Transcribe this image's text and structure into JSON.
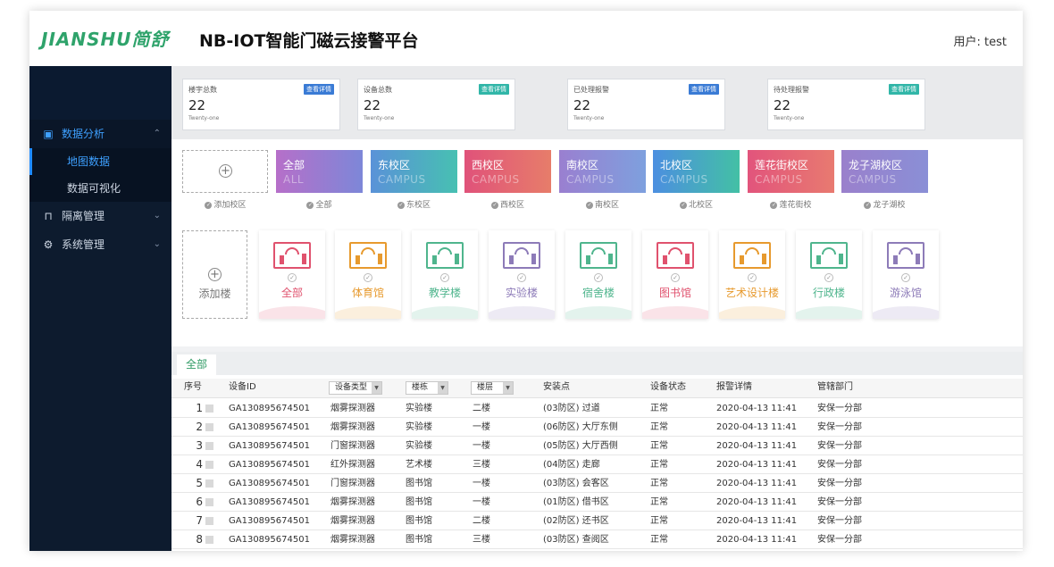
{
  "header": {
    "logo_text": "JIANSHU简舒",
    "title": "NB-IOT智能门磁云接警平台",
    "user_label": "用户: test"
  },
  "sidebar": {
    "groups": [
      {
        "label": "数据分析",
        "icon": "monitor-icon",
        "expanded": true,
        "items": [
          {
            "label": "地图数据",
            "active": true
          },
          {
            "label": "数据可视化",
            "active": false
          }
        ]
      },
      {
        "label": "隔离管理",
        "icon": "door-icon",
        "expanded": false
      },
      {
        "label": "系统管理",
        "icon": "gear-icon",
        "expanded": false
      }
    ]
  },
  "stats": [
    {
      "label": "楼宇总数",
      "badge": "查看详情",
      "value": "22",
      "sub": "Twenty-one",
      "badge_color": "#3a7bd5"
    },
    {
      "label": "设备总数",
      "badge": "查看详情",
      "value": "22",
      "sub": "Twenty-one",
      "badge_color": "#31b6a8"
    },
    {
      "label": "已处理报警",
      "badge": "查看详情",
      "value": "22",
      "sub": "Twenty-one",
      "badge_color": "#3a7bd5"
    },
    {
      "label": "待处理报警",
      "badge": "查看详情",
      "value": "22",
      "sub": "Twenty-one",
      "badge_color": "#31b6a8"
    }
  ],
  "campus": {
    "add_label": "添加校区",
    "items": [
      {
        "name": "全部",
        "sub": "ALL",
        "caption": "全部",
        "color_from": "#b66fc9",
        "color_to": "#7d87d8"
      },
      {
        "name": "东校区",
        "sub": "CAMPUS",
        "caption": "东校区",
        "color_from": "#5a92d8",
        "color_to": "#47c0b2"
      },
      {
        "name": "西校区",
        "sub": "CAMPUS",
        "caption": "西校区",
        "color_from": "#e0527a",
        "color_to": "#e77d6a"
      },
      {
        "name": "南校区",
        "sub": "CAMPUS",
        "caption": "南校区",
        "color_from": "#9a7fd0",
        "color_to": "#7ea0de"
      },
      {
        "name": "北校区",
        "sub": "CAMPUS",
        "caption": "北校区",
        "color_from": "#4c8fe0",
        "color_to": "#43c0a5"
      },
      {
        "name": "莲花街校区",
        "sub": "CAMPUS",
        "caption": "莲花街校",
        "color_from": "#e2547c",
        "color_to": "#e87a70"
      },
      {
        "name": "龙子湖校区",
        "sub": "CAMPUS",
        "caption": "龙子湖校",
        "color_from": "#9a80cc",
        "color_to": "#8a8fd6"
      }
    ]
  },
  "buildings": {
    "add_label": "添加楼",
    "items": [
      {
        "name": "全部",
        "color": "#e0526e"
      },
      {
        "name": "体育馆",
        "color": "#e79a2e"
      },
      {
        "name": "教学楼",
        "color": "#4fb58d"
      },
      {
        "name": "实验楼",
        "color": "#8d7bb8"
      },
      {
        "name": "宿舍楼",
        "color": "#4fb58d"
      },
      {
        "name": "图书馆",
        "color": "#e0526e"
      },
      {
        "name": "艺术设计楼",
        "color": "#e79a2e"
      },
      {
        "name": "行政楼",
        "color": "#4fb58d"
      },
      {
        "name": "游泳馆",
        "color": "#8d7bb8"
      }
    ]
  },
  "table": {
    "tab": "全部",
    "headers": [
      "序号",
      "设备ID",
      "设备类型",
      "楼栋",
      "楼层",
      "安装点",
      "设备状态",
      "报警详情",
      "管辖部门"
    ],
    "rows": [
      [
        "1",
        "GA130895674501",
        "烟雾探测器",
        "实验楼",
        "二楼",
        "(03防区) 过道",
        "正常",
        "2020-04-13 11:41",
        "安保一分部"
      ],
      [
        "2",
        "GA130895674501",
        "烟雾探测器",
        "实验楼",
        "一楼",
        "(06防区) 大厅东侧",
        "正常",
        "2020-04-13 11:41",
        "安保一分部"
      ],
      [
        "3",
        "GA130895674501",
        "门窗探测器",
        "实验楼",
        "一楼",
        "(05防区) 大厅西侧",
        "正常",
        "2020-04-13 11:41",
        "安保一分部"
      ],
      [
        "4",
        "GA130895674501",
        "红外探测器",
        "艺术楼",
        "三楼",
        "(04防区) 走廊",
        "正常",
        "2020-04-13 11:41",
        "安保一分部"
      ],
      [
        "5",
        "GA130895674501",
        "门窗探测器",
        "图书馆",
        "一楼",
        "(03防区) 会客区",
        "正常",
        "2020-04-13 11:41",
        "安保一分部"
      ],
      [
        "6",
        "GA130895674501",
        "烟雾探测器",
        "图书馆",
        "一楼",
        "(01防区) 借书区",
        "正常",
        "2020-04-13 11:41",
        "安保一分部"
      ],
      [
        "7",
        "GA130895674501",
        "烟雾探测器",
        "图书馆",
        "二楼",
        "(02防区) 还书区",
        "正常",
        "2020-04-13 11:41",
        "安保一分部"
      ],
      [
        "8",
        "GA130895674501",
        "烟雾探测器",
        "图书馆",
        "三楼",
        "(03防区) 查阅区",
        "正常",
        "2020-04-13 11:41",
        "安保一分部"
      ]
    ]
  }
}
